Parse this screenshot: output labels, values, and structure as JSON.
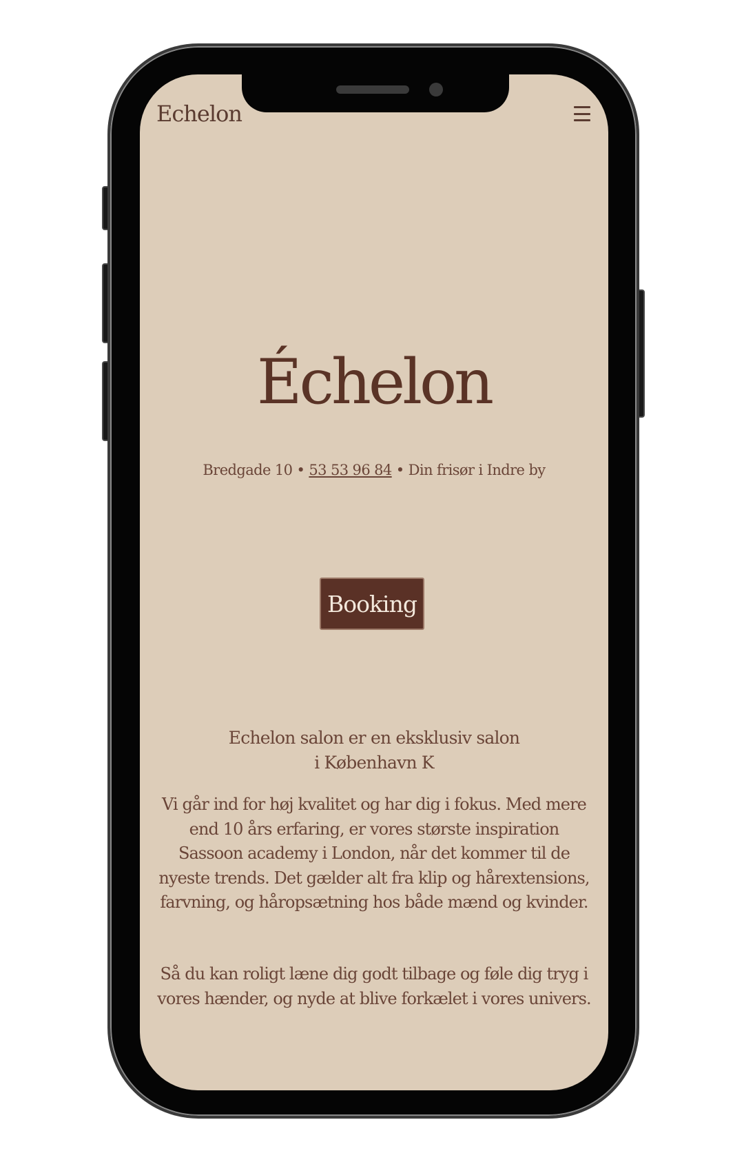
{
  "nav": {
    "logo": "Echelon",
    "menu_icon": "hamburger-menu-icon"
  },
  "hero": {
    "title": "Échelon",
    "address": "Bredgade 10",
    "separator": "•",
    "phone": "53 53 96 84",
    "tagline": "Din frisør i Indre by"
  },
  "booking": {
    "label": "Booking"
  },
  "about": {
    "intro_line1": "Echelon salon er en eksklusiv salon",
    "intro_line2": "i København K",
    "paragraph1": "Vi går ind for høj kvalitet og har dig i fokus. Med mere end 10 års erfaring, er vores største inspiration Sassoon academy i London, når det kommer til de nyeste trends. Det gælder alt fra klip og hårextensions, farvning, og håropsætning hos både mænd og kvinder.",
    "paragraph2": "Så du kan roligt læne dig godt tilbage og føle dig tryg i vores hænder, og nyde at blive forkælet i vores univers."
  },
  "colors": {
    "background": "#ddcdb9",
    "text": "#6a4538",
    "button": "#5a3126",
    "button_text": "#f3e8dc"
  }
}
